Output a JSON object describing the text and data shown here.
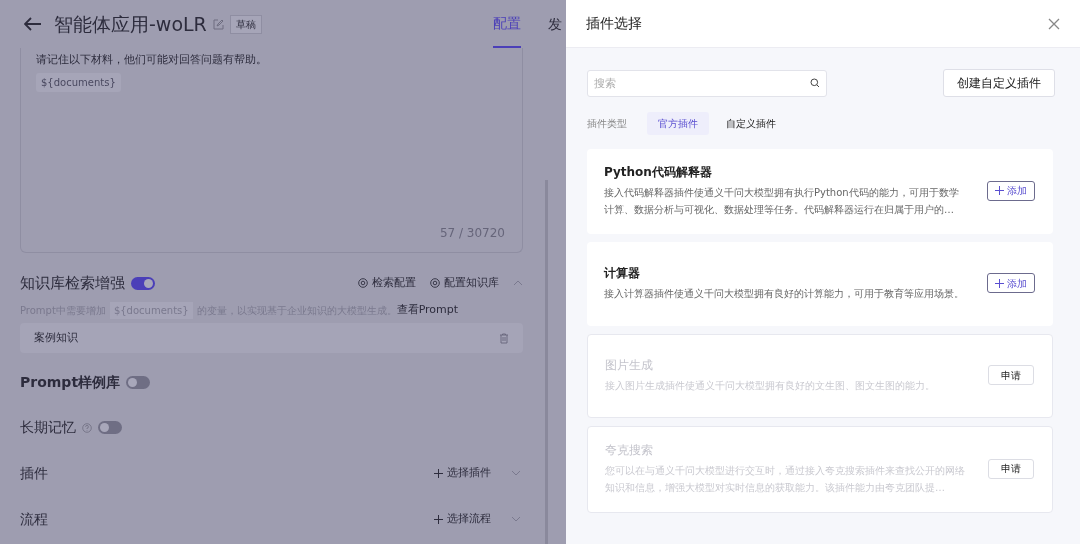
{
  "header": {
    "title": "智能体应用-woLR",
    "status_badge": "草稿",
    "tabs": [
      {
        "label": "配置",
        "selected": true
      },
      {
        "label": "发",
        "selected": false
      }
    ]
  },
  "prompt": {
    "text": "请记住以下材料，他们可能对回答问题有帮助。",
    "variable": "${documents}",
    "counter": "57 / 30720"
  },
  "knowledge": {
    "title": "知识库检索增强",
    "on": true,
    "actions": [
      "检索配置",
      "配置知识库"
    ],
    "expanded": true,
    "hint_before": "Prompt中需要增加",
    "hint_variable": "${documents}",
    "hint_after": "的变量，以实现基于企业知识的大模型生成。",
    "hint_link": "查看Prompt",
    "items": [
      "案例知识"
    ]
  },
  "switches": [
    {
      "label": "Prompt样例库",
      "on": false,
      "help": false
    },
    {
      "label": "长期记忆",
      "on": false,
      "help": true
    }
  ],
  "sections": [
    {
      "label": "插件",
      "action": "选择插件",
      "expanded": false
    },
    {
      "label": "流程",
      "action": "选择流程",
      "expanded": false
    }
  ],
  "drawer": {
    "title": "插件选择",
    "search": {
      "placeholder": "搜索"
    },
    "create_button": "创建自定义插件",
    "filter_label": "插件类型",
    "tabs": [
      {
        "label": "官方插件",
        "selected": true
      },
      {
        "label": "自定义插件",
        "selected": false
      }
    ],
    "plugins": [
      {
        "name": "Python代码解释器",
        "description": "接入代码解释器插件使通义千问大模型拥有执行Python代码的能力，可用于数学计算、数据分析与可视化、数据处理等任务。代码解释器运行在归属于用户的…",
        "kind": "add",
        "button": "添加",
        "disabled": false
      },
      {
        "name": "计算器",
        "description": "接入计算器插件使通义千问大模型拥有良好的计算能力，可用于教育等应用场景。",
        "kind": "add",
        "button": "添加",
        "disabled": false
      },
      {
        "name": "图片生成",
        "description": "接入图片生成插件使通义千问大模型拥有良好的文生图、图文生图的能力。",
        "kind": "apply",
        "button": "申请",
        "disabled": true
      },
      {
        "name": "夸克搜索",
        "description": "您可以在与通义千问大模型进行交互时，通过接入夸克搜索插件来查找公开的网络知识和信息，增强大模型对实时信息的获取能力。该插件能力由夸克团队提…",
        "kind": "apply",
        "button": "申请",
        "disabled": true
      }
    ]
  }
}
